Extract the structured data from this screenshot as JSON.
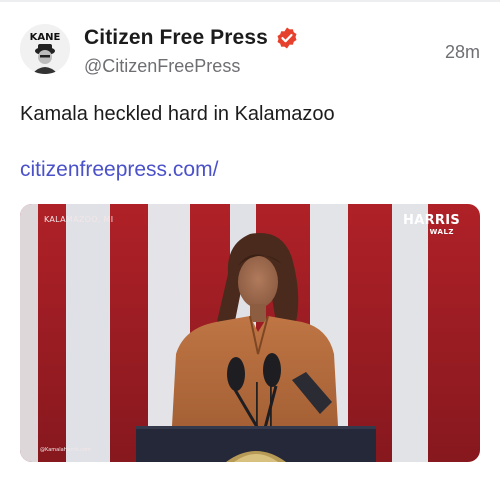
{
  "post": {
    "author_name": "Citizen Free Press",
    "handle": "@CitizenFreePress",
    "timestamp": "28m",
    "text": "Kamala heckled hard in Kalamazoo",
    "link": "citizenfreepress.com/",
    "avatar_label": "KANE"
  },
  "media": {
    "location_label": "KALAMAZOO, MI",
    "logo_line1": "HARRIS",
    "logo_line2": "WALZ",
    "credit": "@KamalaHarris.com"
  },
  "colors": {
    "verified_badge": "#e6412c",
    "link": "#4b52c9",
    "stripe_red": "#c22a2f",
    "stripe_white": "#eef0f4",
    "jacket": "#b36a3e"
  }
}
